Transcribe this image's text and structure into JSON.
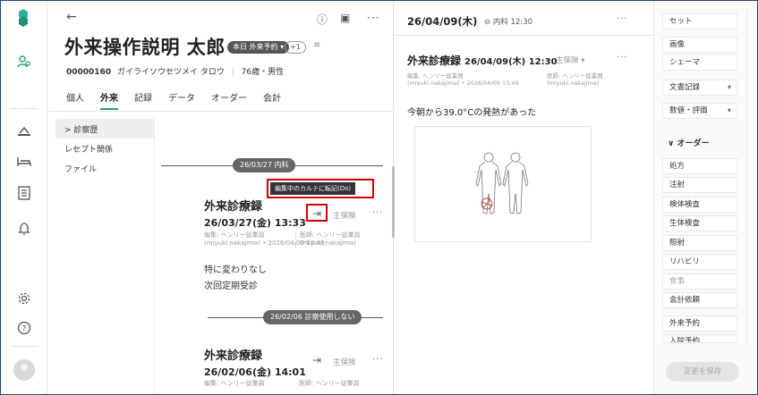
{
  "rail": {
    "icons": [
      "logo",
      "patient-search-icon",
      "reception-icon",
      "bed-icon",
      "list-icon",
      "bell-icon",
      "settings-icon",
      "help-icon",
      "user-avatar"
    ]
  },
  "patient": {
    "back": "←",
    "name": "外来操作説明 太郎",
    "badge": "本日 外来予約 ▾",
    "plus_count": "+1",
    "menu_glyph": "≡",
    "id": "00000160",
    "kana": "ガイライソウセツメイ タロウ",
    "age_sex": "76歳・男性",
    "tabs": [
      "個人",
      "外来",
      "記録",
      "データ",
      "オーダー",
      "会計"
    ],
    "active_tab": "外来",
    "subnav": [
      "> 診察歴",
      "レセプト関係",
      "ファイル"
    ],
    "toolbar": {
      "id_icon_glyph": "ⓘ",
      "card_icon_glyph": "▣",
      "more": "···"
    }
  },
  "records": [
    {
      "date_pill": "26/03/27 内科",
      "title": "外来診療録",
      "date": "26/03/27(金) 13:33",
      "insurance": "主保険",
      "meta_editor": "編集: ヘンリー従業員",
      "meta_editor2": "(miyuki.nakajima) • 2026/04/09 13:49",
      "meta_doctor": "医師: ヘンリー従業員",
      "meta_doctor2": "(miyuki.nakajima)",
      "body": [
        "特に変わりなし",
        "次回定期受診"
      ],
      "tooltip": "編集中のカルテに転記(Do)"
    },
    {
      "date_pill": "26/02/06 診察使用しない",
      "title": "外来診療録",
      "date": "26/02/06(金) 14:01",
      "insurance": "主保険",
      "meta_editor": "編集: ヘンリー従業員",
      "meta_doctor": "医師: ヘンリー従業員"
    }
  ],
  "visit": {
    "date": "26/04/09(木)",
    "link": "⊝ 内科 12:30",
    "title": "外来診療録",
    "title_date": "26/04/09(木) 12:30",
    "insurance": "主保険 ▾",
    "meta_editor": "編集: ヘンリー従業員",
    "meta_editor2": "(miyuki.nakajima) • 2026/04/09 13:49",
    "meta_doctor": "医師: ヘンリー従業員",
    "meta_doctor2": "(miyuki.nakajima)",
    "text": "今朝から39.0°Cの発熱があった"
  },
  "side": {
    "buttons_top": [
      "セット",
      "画像",
      "シェーマ"
    ],
    "dropdowns": [
      "文書記録",
      "数値・評価"
    ],
    "order_header": "∨ オーダー",
    "orders": [
      "処方",
      "注射",
      "検体検査",
      "生体検査",
      "照射",
      "リハビリ",
      "食事",
      "会計依頼",
      "外来予約",
      "入院予約"
    ],
    "save": "変更を保存"
  },
  "colors": {
    "accent": "#2a9a7e",
    "highlight": "#d40000",
    "logo": "#2bb39a"
  }
}
